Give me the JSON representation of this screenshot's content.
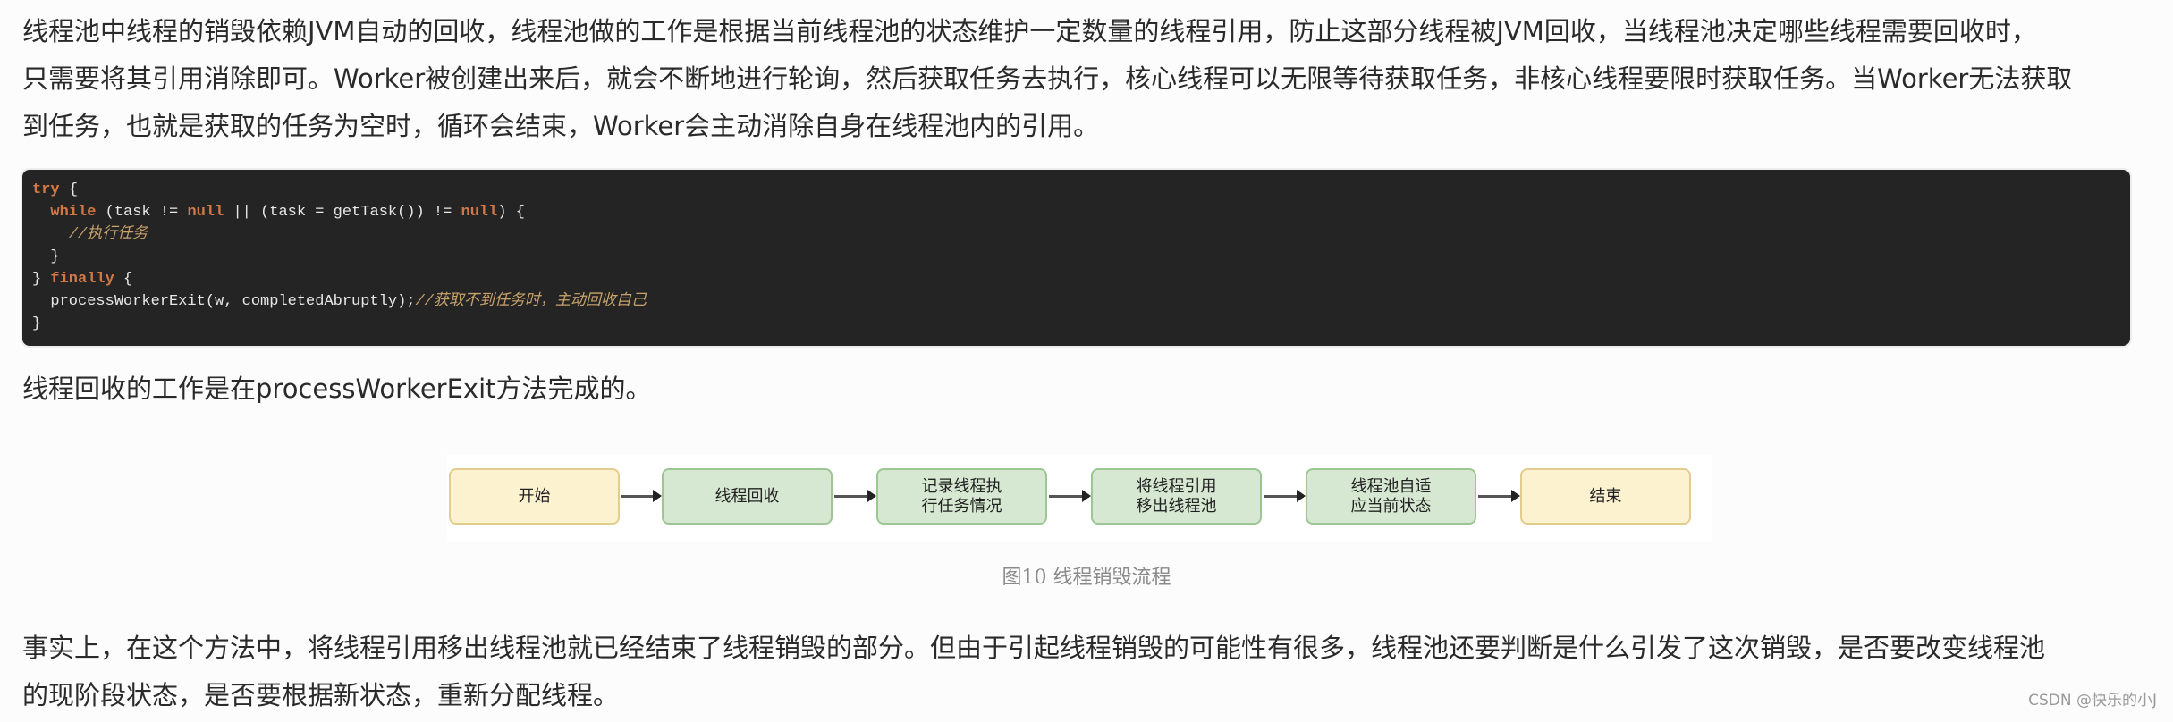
{
  "paragraph1": {
    "lines": [
      "线程池中线程的销毁依赖JVM自动的回收，线程池做的工作是根据当前线程池的状态维护一定数量的线程引用，防止这部分线程被JVM回收，当线程池决定哪些线程需要回收时，",
      "只需要将其引用消除即可。Worker被创建出来后，就会不断地进行轮询，然后获取任务去执行，核心线程可以无限等待获取任务，非核心线程要限时获取任务。当Worker无法获取",
      "到任务，也就是获取的任务为空时，循环会结束，Worker会主动消除自身在线程池内的引用。"
    ]
  },
  "code_block": {
    "lines": [
      {
        "parts": [
          {
            "t": "try",
            "c": "kw"
          },
          {
            "t": " {",
            "c": ""
          }
        ]
      },
      {
        "parts": [
          {
            "t": "  ",
            "c": ""
          },
          {
            "t": "while",
            "c": "kw"
          },
          {
            "t": " (task != ",
            "c": ""
          },
          {
            "t": "null",
            "c": "kw"
          },
          {
            "t": " || (task = getTask()) != ",
            "c": ""
          },
          {
            "t": "null",
            "c": "kw"
          },
          {
            "t": ") {",
            "c": ""
          }
        ]
      },
      {
        "parts": [
          {
            "t": "    ",
            "c": ""
          },
          {
            "t": "//执行任务",
            "c": "cm"
          }
        ]
      },
      {
        "parts": [
          {
            "t": "  }",
            "c": ""
          }
        ]
      },
      {
        "parts": [
          {
            "t": "} ",
            "c": ""
          },
          {
            "t": "finally",
            "c": "kw"
          },
          {
            "t": " {",
            "c": ""
          }
        ]
      },
      {
        "parts": [
          {
            "t": "  processWorkerExit(w, completedAbruptly);",
            "c": ""
          },
          {
            "t": "//获取不到任务时，主动回收自己",
            "c": "cm"
          }
        ]
      },
      {
        "parts": [
          {
            "t": "}",
            "c": ""
          }
        ]
      }
    ]
  },
  "paragraph2": {
    "text": "线程回收的工作是在processWorkerExit方法完成的。"
  },
  "figure": {
    "nodes": [
      {
        "label": "开始",
        "style": "yellow"
      },
      {
        "label": "线程回收",
        "style": "green"
      },
      {
        "label": "记录线程执\n行任务情况",
        "style": "green"
      },
      {
        "label": "将线程引用\n移出线程池",
        "style": "green"
      },
      {
        "label": "线程池自适\n应当前状态",
        "style": "green"
      },
      {
        "label": "结束",
        "style": "yellow"
      }
    ],
    "caption": "图10 线程销毁流程",
    "colors": {
      "yellow_fill": "#fdf2cf",
      "green_fill": "#d7e8d2"
    }
  },
  "paragraph3": {
    "lines": [
      "事实上，在这个方法中，将线程引用移出线程池就已经结束了线程销毁的部分。但由于引起线程销毁的可能性有很多，线程池还要判断是什么引发了这次销毁，是否要改变线程池",
      "的现阶段状态，是否要根据新状态，重新分配线程。"
    ]
  },
  "watermark": "CSDN @快乐的小J"
}
